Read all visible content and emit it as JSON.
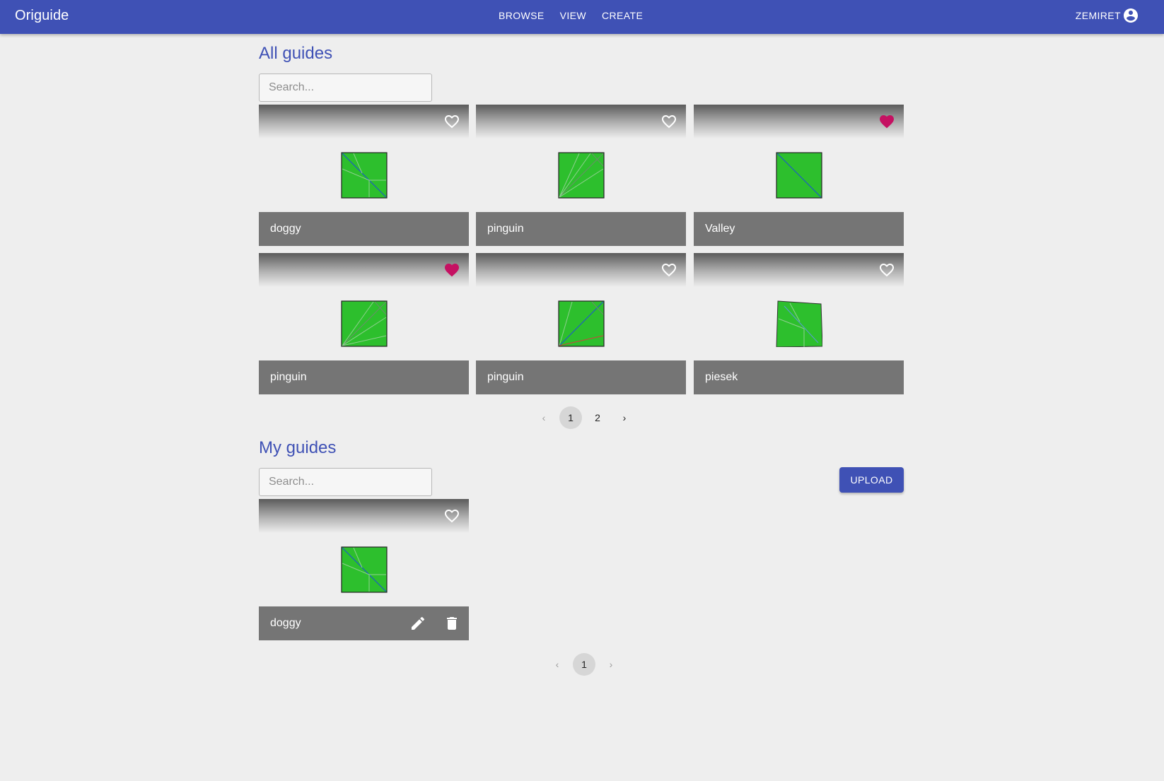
{
  "appbar": {
    "brand": "Origuide",
    "nav": [
      "BROWSE",
      "VIEW",
      "CREATE"
    ],
    "username": "ZEMIRET"
  },
  "all_guides": {
    "title": "All guides",
    "search_placeholder": "Search...",
    "cards": [
      {
        "title": "doggy",
        "favorited": false
      },
      {
        "title": "pinguin",
        "favorited": false
      },
      {
        "title": "Valley",
        "favorited": true
      },
      {
        "title": "pinguin",
        "favorited": true
      },
      {
        "title": "pinguin",
        "favorited": false
      },
      {
        "title": "piesek",
        "favorited": false
      }
    ],
    "pagination": {
      "prev": "‹",
      "pages": [
        "1",
        "2"
      ],
      "current": "1",
      "next": "›"
    }
  },
  "my_guides": {
    "title": "My guides",
    "search_placeholder": "Search...",
    "upload_label": "UPLOAD",
    "cards": [
      {
        "title": "doggy",
        "favorited": false
      }
    ],
    "pagination": {
      "prev": "‹",
      "pages": [
        "1"
      ],
      "current": "1",
      "next": "›"
    }
  },
  "colors": {
    "primary": "#3f51b5",
    "favorite": "#c51162",
    "paper_green": "#2dbf2d",
    "card_bar": "#757575"
  }
}
